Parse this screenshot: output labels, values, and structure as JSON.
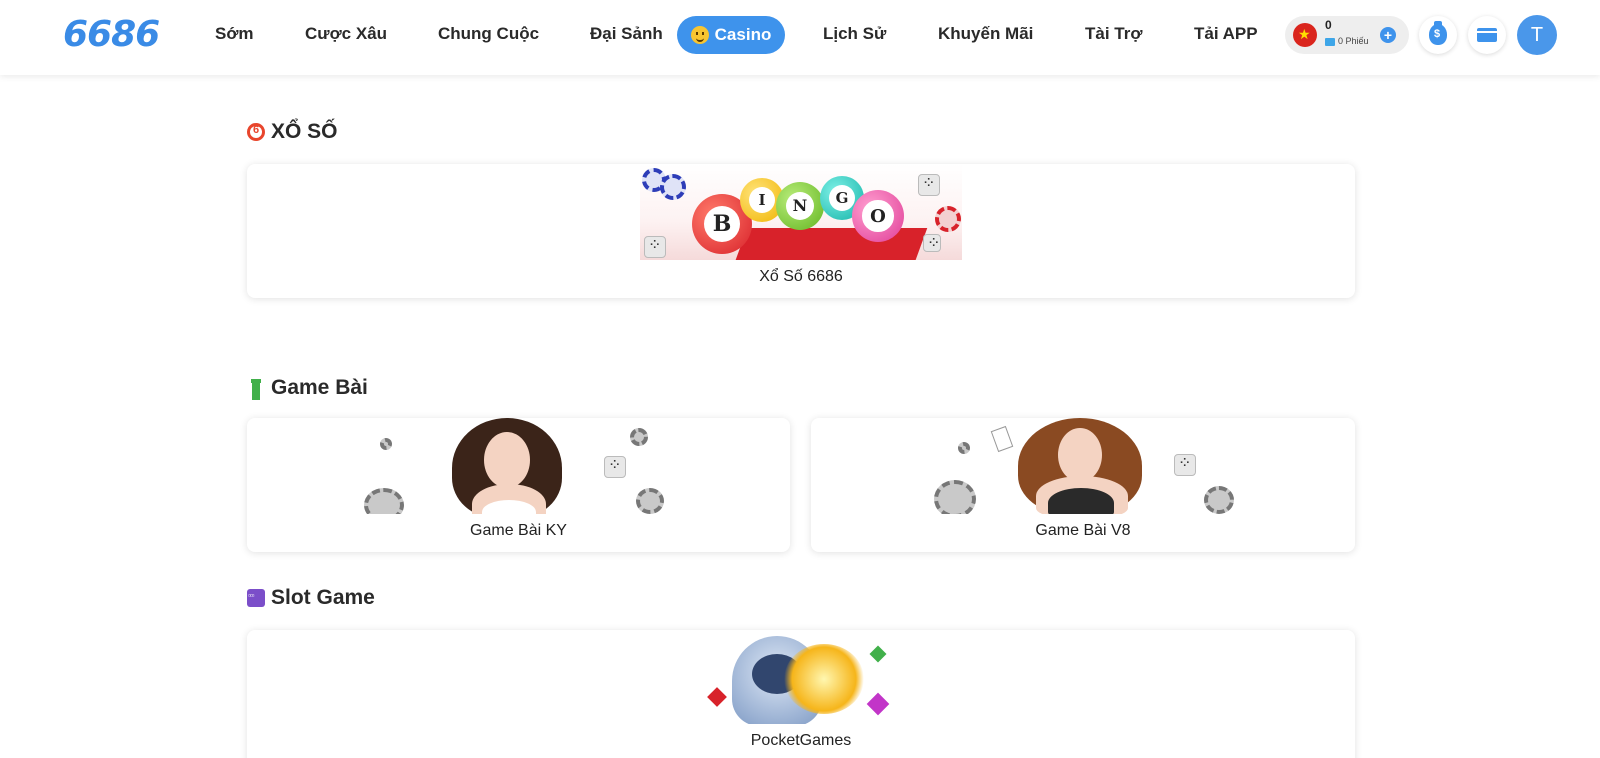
{
  "header": {
    "logo": "6686",
    "nav": [
      "Sớm",
      "Cược Xâu",
      "Chung Cuộc",
      "Đại Sảnh",
      "Lịch Sử",
      "Khuyến Mãi",
      "Tài Trợ",
      "Tải APP"
    ],
    "casino_label": "Casino",
    "balance": "0",
    "ticket_text": "0 Phiếu",
    "avatar_letter": "T"
  },
  "sections": {
    "lottery": {
      "title": "XỔ SỐ",
      "items": [
        "Xổ Số 6686"
      ]
    },
    "card_games": {
      "title": "Game Bài",
      "items": [
        "Game Bài KY",
        "Game Bài V8"
      ]
    },
    "slot": {
      "title": "Slot Game",
      "items": [
        "PocketGames"
      ]
    }
  },
  "banner_text": {
    "bingo": [
      "B",
      "I",
      "N",
      "G",
      "O"
    ]
  },
  "colors": {
    "accent": "#3e93ec",
    "lottery_red": "#e8452c",
    "rook_green": "#41b04a",
    "slot_purple": "#7b4ec9"
  }
}
